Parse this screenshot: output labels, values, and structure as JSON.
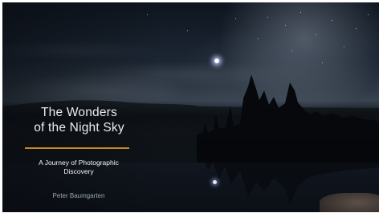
{
  "slide": {
    "title_line1": "The Wonders",
    "title_line2": "of the Night Sky",
    "subtitle_line1": "A Journey of Photographic",
    "subtitle_line2": "Discovery",
    "author": "Peter Baumgarten"
  },
  "colors": {
    "accent_divider": "#c98a25",
    "title_text": "#e8edf2",
    "author_text": "#9aa6b3"
  }
}
